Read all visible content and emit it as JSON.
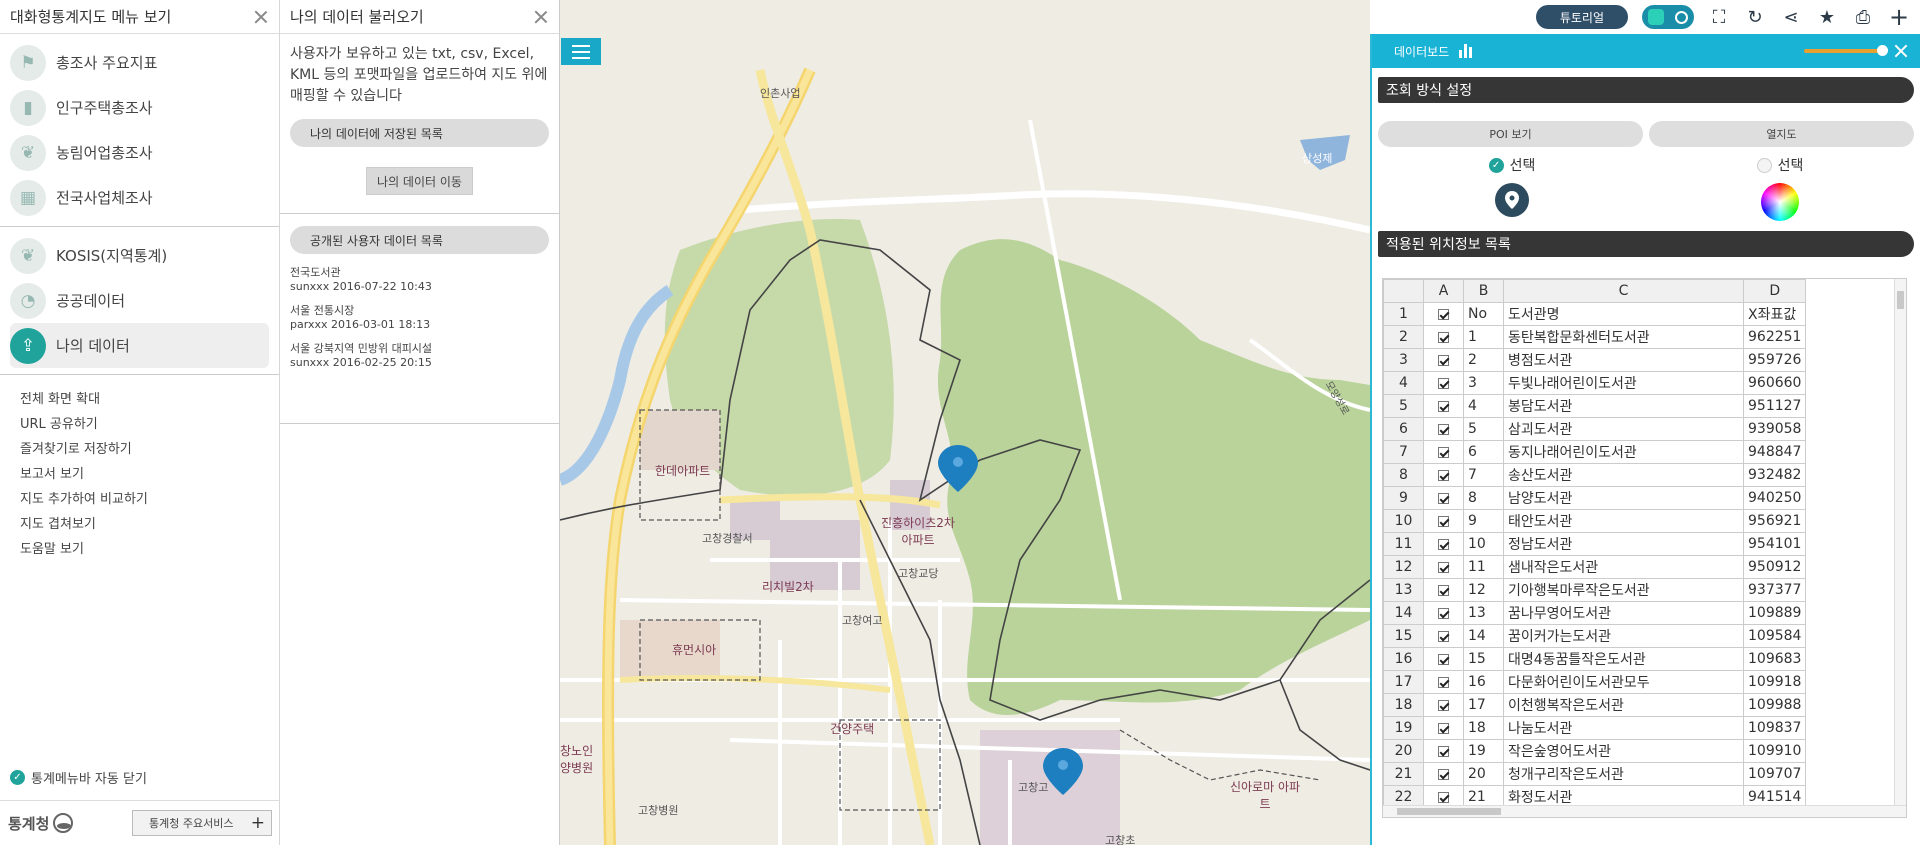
{
  "left_menu": {
    "title": "대화형통계지도 메뉴 보기",
    "group1": [
      {
        "label": "총조사 주요지표",
        "icon": "signpost-icon"
      },
      {
        "label": "인구주택총조사",
        "icon": "bar-chart-icon"
      },
      {
        "label": "농림어업총조사",
        "icon": "leaf-icon"
      },
      {
        "label": "전국사업체조사",
        "icon": "building-icon"
      }
    ],
    "group2": [
      {
        "label": "KOSIS(지역통계)",
        "icon": "leaf-icon"
      },
      {
        "label": "공공데이터",
        "icon": "pie-chart-icon"
      },
      {
        "label": "나의 데이터",
        "icon": "upload-icon"
      }
    ],
    "links": [
      "전체 화면 확대",
      "URL 공유하기",
      "즐겨찾기로 저장하기",
      "보고서 보기",
      "지도 추가하여 비교하기",
      "지도 겹쳐보기",
      "도움말 보기"
    ],
    "auto_close": "통계메뉴바 자동 닫기",
    "logo": "통계청",
    "service_button": "통계청 주요서비스"
  },
  "data_panel": {
    "title": "나의 데이터 불러오기",
    "description": "사용자가 보유하고 있는 txt, csv, Excel, KML 등의 포맷파일을 업로드하여 지도 위에 매핑할 수 있습니다",
    "saved_list_label": "나의 데이터에 저장된 목록",
    "move_button": "나의 데이터 이동",
    "public_list_label": "공개된 사용자 데이터 목록",
    "public_items": [
      {
        "name": "전국도서관",
        "meta": "sunxxx 2016-07-22 10:43"
      },
      {
        "name": "서울 전통시장",
        "meta": "parxxx 2016-03-01 18:13"
      },
      {
        "name": "서울 강북지역 민방위 대피시설",
        "meta": "sunxxx 2016-02-25 20:15"
      }
    ]
  },
  "map": {
    "labels": [
      "인촌사업",
      "상성제",
      "한데아파트",
      "고창경찰서",
      "진흥하이츠2차 아파트",
      "고창교당",
      "리치빌2차",
      "고창여고",
      "휴먼시아",
      "건양주택",
      "창노인 양병원",
      "고창병원",
      "고창고",
      "신아로마 아파트",
      "고창초",
      "모양성로"
    ]
  },
  "toolbar": {
    "tutorial": "튜토리얼",
    "icons": [
      "fullscreen-icon",
      "refresh-icon",
      "share-icon",
      "star-icon",
      "print-icon",
      "plus-icon"
    ]
  },
  "dashboard": {
    "title": "데이터보드",
    "query_section": "조회 방식 설정",
    "poi_button": "POI 보기",
    "heat_button": "열지도",
    "select_label": "선택",
    "list_section": "적용된 위치정보 목록",
    "columns": [
      "A",
      "B",
      "C",
      "D"
    ],
    "header_row": {
      "no": "No",
      "name": "도서관명",
      "x": "X좌표값"
    },
    "rows": [
      {
        "no": "1",
        "name": "동탄복합문화센터도서관",
        "x": "962251"
      },
      {
        "no": "2",
        "name": "병점도서관",
        "x": "959726"
      },
      {
        "no": "3",
        "name": "두빛나래어린이도서관",
        "x": "960660"
      },
      {
        "no": "4",
        "name": "봉담도서관",
        "x": "951127"
      },
      {
        "no": "5",
        "name": "삼괴도서관",
        "x": "939058"
      },
      {
        "no": "6",
        "name": "동지나래어린이도서관",
        "x": "948847"
      },
      {
        "no": "7",
        "name": "송산도서관",
        "x": "932482"
      },
      {
        "no": "8",
        "name": "남양도서관",
        "x": "940250"
      },
      {
        "no": "9",
        "name": "태안도서관",
        "x": "956921"
      },
      {
        "no": "10",
        "name": "정남도서관",
        "x": "954101"
      },
      {
        "no": "11",
        "name": "샘내작은도서관",
        "x": "950912"
      },
      {
        "no": "12",
        "name": "기아행복마루작은도서관",
        "x": "937377"
      },
      {
        "no": "13",
        "name": "꿈나무영어도서관",
        "x": "109889"
      },
      {
        "no": "14",
        "name": "꿈이커가는도서관",
        "x": "109584"
      },
      {
        "no": "15",
        "name": "대명4동꿈틀작은도서관",
        "x": "109683"
      },
      {
        "no": "16",
        "name": "다문화어린이도서관모두",
        "x": "109918"
      },
      {
        "no": "17",
        "name": "이천행복작은도서관",
        "x": "109988"
      },
      {
        "no": "18",
        "name": "나눔도서관",
        "x": "109837"
      },
      {
        "no": "19",
        "name": "작은숲영어도서관",
        "x": "109910"
      },
      {
        "no": "20",
        "name": "청개구리작은도서관",
        "x": "109707"
      },
      {
        "no": "21",
        "name": "화정도서관",
        "x": "941514"
      }
    ]
  }
}
